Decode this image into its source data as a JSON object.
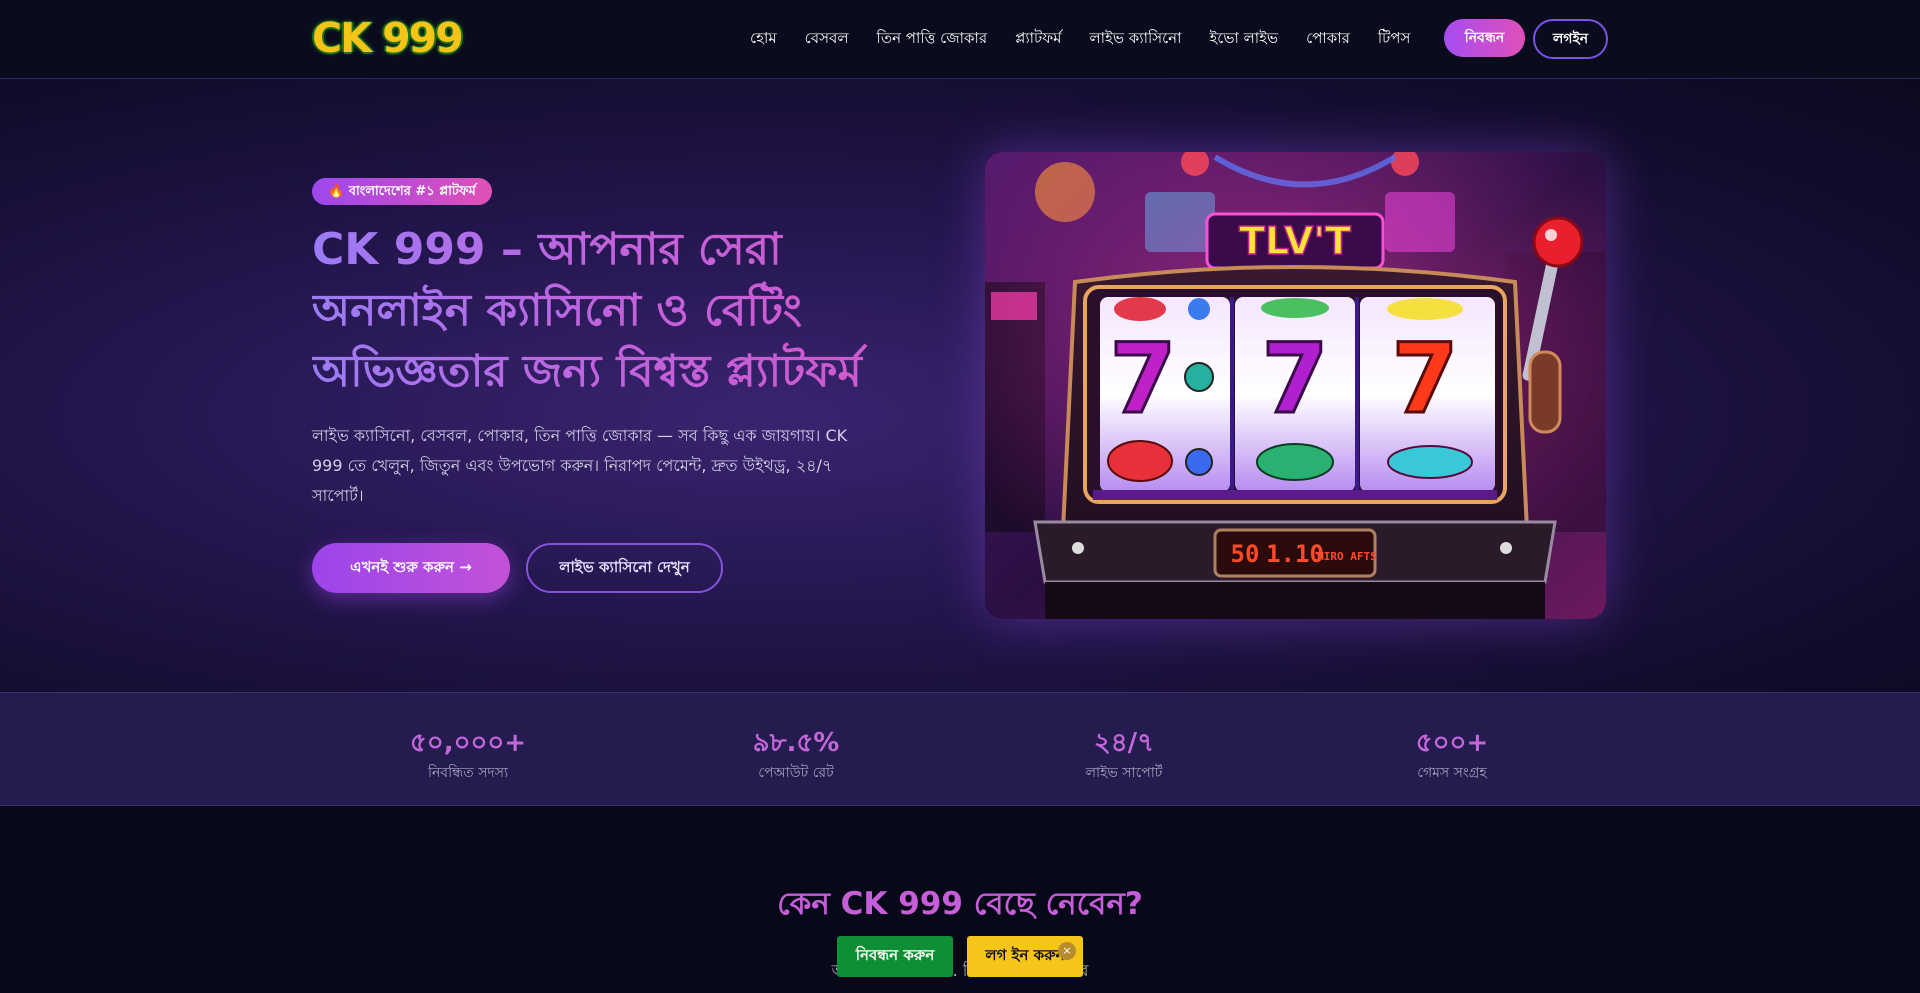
{
  "header": {
    "logo_text": "CK 999",
    "nav": [
      "হোম",
      "বেসবল",
      "তিন পাত্তি জোকার",
      "প্ল্যাটফর্ম",
      "লাইভ ক্যাসিনো",
      "ইভো লাইভ",
      "পোকার",
      "টিপস"
    ],
    "register_label": "নিবন্ধন",
    "login_label": "লগইন"
  },
  "hero": {
    "badge": "🔥 বাংলাদেশের #১ প্লাটফর্ম",
    "title": "CK 999 – আপনার সেরা অনলাইন ক্যাসিনো ও বেটিং অভিজ্ঞতার জন্য বিশ্বস্ত প্ল্যাটফর্ম",
    "description": "লাইভ ক্যাসিনো, বেসবল, পোকার, তিন পাত্তি জোকার — সব কিছু এক জায়গায়। CK 999 তে খেলুন, জিতুন এবং উপভোগ করুন। নিরাপদ পেমেন্ট, দ্রুত উইথড্র, ২৪/৭ সাপোর্ট।",
    "cta_primary": "এখনই শুরু করুন →",
    "cta_secondary": "লাইভ ক্যাসিনো দেখুন",
    "machine_sign": "TLV'T",
    "machine_display": [
      "50",
      "1.10",
      "MIRO AFTS"
    ],
    "reel_digit": "7"
  },
  "stats": [
    {
      "value": "৫০,০০০+",
      "label": "নিবন্ধিত সদস্য"
    },
    {
      "value": "৯৮.৫%",
      "label": "পেআউট রেট"
    },
    {
      "value": "২৪/৭",
      "label": "লাইভ সাপোর্ট"
    },
    {
      "value": "৫০০+",
      "label": "গেমস সংগ্রহ"
    }
  ],
  "why": {
    "title": "কেন CK 999 বেছে নেবেন?",
    "subtitle": "আমাদের প্লাটফর্ম ... নিরাপত্তা প্রদান করে"
  },
  "floating": {
    "register_label": "নিবন্ধন করুন",
    "login_label": "লগ ইন করুন",
    "close_icon": "×"
  },
  "colors": {
    "accent_purple": "#a64df0",
    "accent_pink": "#e04fb8",
    "register_green": "#0e8f33",
    "login_yellow": "#f5c51a",
    "background": "#070818"
  }
}
